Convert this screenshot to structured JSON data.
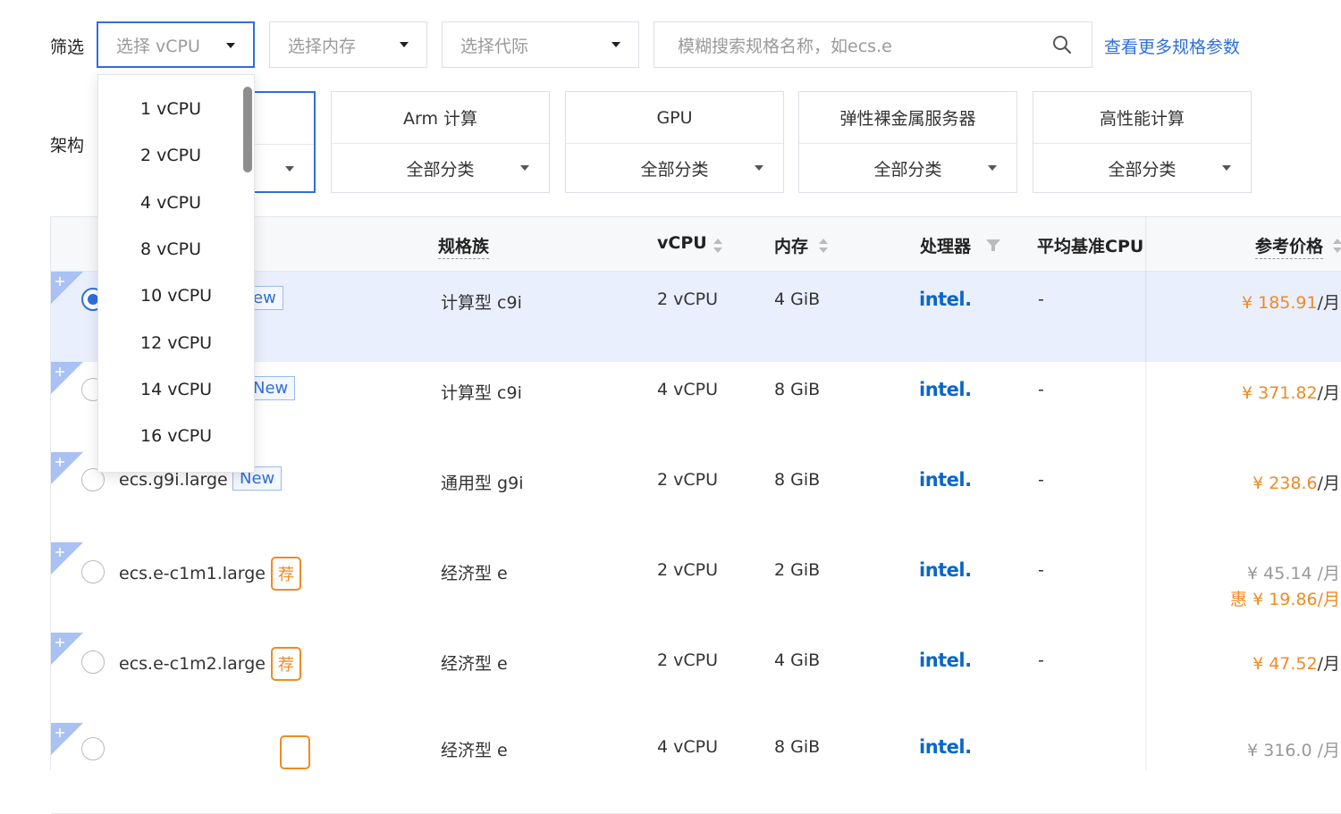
{
  "filter": {
    "label": "筛选",
    "vcpu_placeholder": "选择 vCPU",
    "memory_placeholder": "选择内存",
    "generation_placeholder": "选择代际",
    "search_placeholder": "模糊搜索规格名称，如ecs.e",
    "more_link": "查看更多规格参数"
  },
  "arch": {
    "label": "架构",
    "cards": [
      {
        "name": "",
        "category": ""
      },
      {
        "name": "Arm 计算",
        "category": "全部分类"
      },
      {
        "name": "GPU",
        "category": "全部分类"
      },
      {
        "name": "弹性裸金属服务器",
        "category": "全部分类"
      },
      {
        "name": "高性能计算",
        "category": "全部分类"
      }
    ]
  },
  "vcpu_dropdown": {
    "options": [
      "1 vCPU",
      "2 vCPU",
      "4 vCPU",
      "8 vCPU",
      "10 vCPU",
      "12 vCPU",
      "14 vCPU",
      "16 vCPU"
    ]
  },
  "table": {
    "headers": {
      "family": "规格族",
      "vcpu": "vCPU",
      "memory": "内存",
      "processor": "处理器",
      "baseline_cpu": "平均基准CPU",
      "price": "参考价格"
    },
    "rows": [
      {
        "spec": "",
        "badge": "ew",
        "family": "计算型 c9i",
        "vcpu": "2 vCPU",
        "memory": "4 GiB",
        "processor": "intel.",
        "baseline": "-",
        "price": "¥ 185.91",
        "unit": "/月",
        "selected": true
      },
      {
        "spec": "",
        "badge": "New",
        "family": "计算型 c9i",
        "vcpu": "4 vCPU",
        "memory": "8 GiB",
        "processor": "intel.",
        "baseline": "-",
        "price": "¥ 371.82",
        "unit": "/月",
        "selected": false
      },
      {
        "spec": "ecs.g9i.large",
        "badge": "New",
        "family": "通用型 g9i",
        "vcpu": "2 vCPU",
        "memory": "8 GiB",
        "processor": "intel.",
        "baseline": "-",
        "price": "¥ 238.6",
        "unit": "/月",
        "selected": false
      },
      {
        "spec": "ecs.e-c1m1.large",
        "badge": "荐",
        "family": "经济型 e",
        "vcpu": "2 vCPU",
        "memory": "2 GiB",
        "processor": "intel.",
        "baseline": "-",
        "price_original": "¥ 45.14 /月",
        "price": "惠 ¥ 19.86",
        "unit": "/月",
        "selected": false
      },
      {
        "spec": "ecs.e-c1m2.large",
        "badge": "荐",
        "family": "经济型 e",
        "vcpu": "2 vCPU",
        "memory": "4 GiB",
        "processor": "intel.",
        "baseline": "-",
        "price": "¥ 47.52",
        "unit": "/月",
        "selected": false
      },
      {
        "spec": "",
        "badge": "",
        "family": "经济型 e",
        "vcpu": "4 vCPU",
        "memory": "8 GiB",
        "processor": "intel.",
        "baseline": "",
        "price": "¥ 316.0 /月",
        "unit": "",
        "selected": false
      }
    ]
  },
  "colors": {
    "accent": "#2f6fdc",
    "price": "#f08a24",
    "selected_row": "#e9effc"
  }
}
